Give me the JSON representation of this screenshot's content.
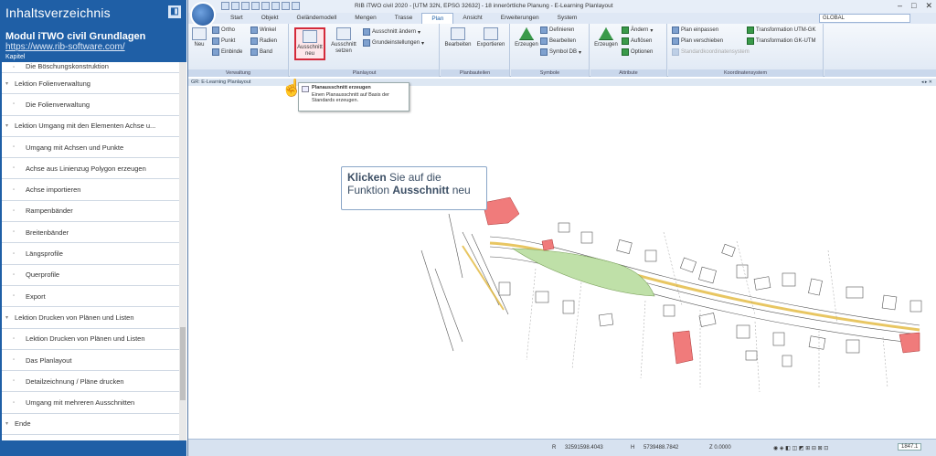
{
  "toc": {
    "title": "Inhaltsverzeichnis",
    "module": "Modul iTWO civil Grundlagen",
    "link": "https://www.rib-software.com/",
    "chapter_label": "Kapitel",
    "items": [
      {
        "label": "Die Böschungskonstruktion",
        "level": 1,
        "partial": true
      },
      {
        "label": "Lektion Folienverwaltung",
        "level": 0
      },
      {
        "label": "Die Folienverwaltung",
        "level": 1
      },
      {
        "label": "Lektion Umgang mit den Elementen Achse u...",
        "level": 0
      },
      {
        "label": "Umgang mit Achsen und Punkte",
        "level": 1
      },
      {
        "label": "Achse aus Linienzug Polygon erzeugen",
        "level": 1
      },
      {
        "label": "Achse importieren",
        "level": 1
      },
      {
        "label": "Rampenbänder",
        "level": 1
      },
      {
        "label": "Breitenbänder",
        "level": 1
      },
      {
        "label": "Längsprofile",
        "level": 1
      },
      {
        "label": "Querprofile",
        "level": 1
      },
      {
        "label": "Export",
        "level": 1
      },
      {
        "label": "Lektion Drucken von Plänen und Listen",
        "level": 0
      },
      {
        "label": "Lektion Drucken von Plänen und Listen",
        "level": 1
      },
      {
        "label": "Das Planlayout",
        "level": 1
      },
      {
        "label": "Detailzeichnung / Pläne drucken",
        "level": 1
      },
      {
        "label": "Umgang mit mehreren Ausschnitten",
        "level": 1
      },
      {
        "label": "Ende",
        "level": 0
      }
    ]
  },
  "app": {
    "title": "RIB iTWO civil 2020 - [UTM 32N, EPSG 32632] - 18 innerörtliche Planung - E-Learning Planlayout",
    "tabs": [
      "Start",
      "Objekt",
      "Geländemodell",
      "Mengen",
      "Trasse",
      "Plan",
      "Ansicht",
      "Erweiterungen",
      "System"
    ],
    "active_tab": "Plan",
    "global_select": "GLOBAL",
    "ribbon": {
      "neu": "Neu",
      "ortho": "Ortho",
      "winkel": "Winkel",
      "punkt": "Punkt",
      "radien": "Radien",
      "einbinde": "Einbinde",
      "band": "Band",
      "group1": "Verwaltung",
      "ausschnitt_neu": "Ausschnitt neu",
      "ausschnitt_setzen": "Ausschnitt setzen",
      "ausschnitt_aendern": "Ausschnitt ändern",
      "grundeinstellungen": "Grundeinstellungen",
      "group2": "Planlayout",
      "bearbeiten": "Bearbeiten",
      "exportieren": "Exportieren",
      "group3": "Planbauteilen",
      "erzeugen": "Erzeugen",
      "definieren": "Definieren",
      "bearbeiten2": "Bearbeiten",
      "symbol_db": "Symbol DB",
      "group4": "Symbole",
      "erzeugen2": "Erzeugen",
      "aendern": "Ändern",
      "aufloesen": "Auflösen",
      "optionen": "Optionen",
      "group5": "Attribute",
      "plan_einpassen": "Plan einpassen",
      "plan_verschieben": "Plan verschieben",
      "koordinatensystem_btn": "Standardkoordinatensystem",
      "trans_utm_gk": "Transformation UTM-GK",
      "trans_gk_utm": "Transformation GK-UTM",
      "group6": "Koordinatensystem"
    },
    "doc_tab": "GR: E-Learning Planlayout",
    "tooltip": {
      "title": "Planausschnitt erzeugen",
      "body": "Einen Planausschnitt auf Basis der Standards erzeugen."
    },
    "callout": {
      "bold1": "Klicken",
      "text1": " Sie auf die Funktion ",
      "bold2": "Ausschnitt",
      "text2": " neu"
    },
    "status": {
      "r_label": "R",
      "r_value": "32591598.4043",
      "h_label": "H",
      "h_value": "5739488.7842",
      "z_value": "Z 0.0000",
      "zoom": "1847.1"
    }
  }
}
